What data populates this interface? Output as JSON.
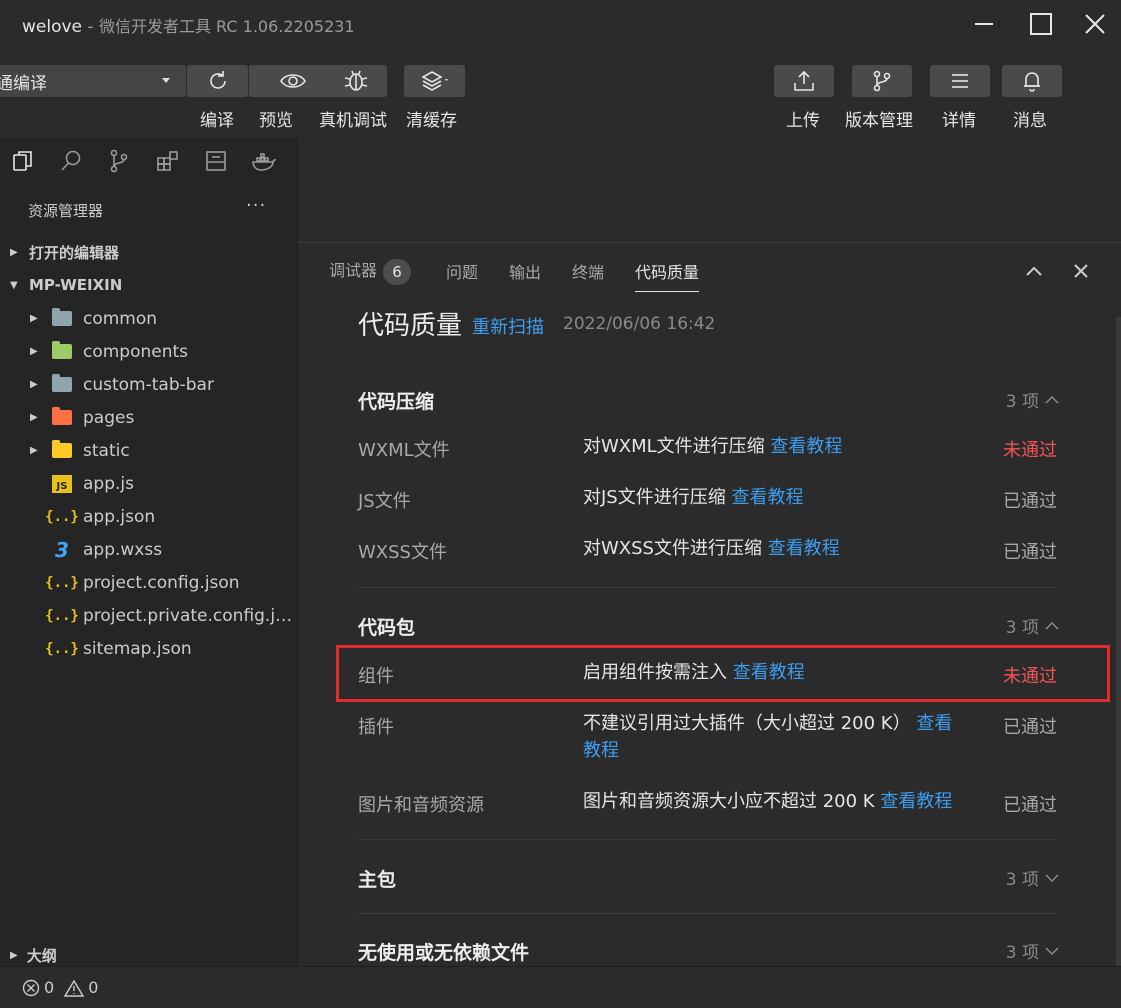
{
  "window": {
    "app_name": "welove",
    "separator": "-",
    "subtitle": "微信开发者工具 RC 1.06.2205231"
  },
  "toolbar": {
    "mode_value": "通编译",
    "compile_label": "编译",
    "preview_label": "预览",
    "debug_label": "真机调试",
    "clear_cache_label": "清缓存",
    "upload_label": "上传",
    "version_label": "版本管理",
    "details_label": "详情",
    "messages_label": "消息"
  },
  "sidebar": {
    "explorer_title": "资源管理器",
    "more": "···",
    "open_editors": "打开的编辑器",
    "project": "MP-WEIXIN",
    "outline": "大纲",
    "tree": [
      {
        "name": "common"
      },
      {
        "name": "components"
      },
      {
        "name": "custom-tab-bar"
      },
      {
        "name": "pages"
      },
      {
        "name": "static"
      },
      {
        "name": "app.js"
      },
      {
        "name": "app.json"
      },
      {
        "name": "app.wxss"
      },
      {
        "name": "project.config.json"
      },
      {
        "name": "project.private.config.js..."
      },
      {
        "name": "sitemap.json"
      }
    ]
  },
  "panel": {
    "tabs": [
      {
        "label": "调试器",
        "badge": "6"
      },
      {
        "label": "问题"
      },
      {
        "label": "输出"
      },
      {
        "label": "终端"
      },
      {
        "label": "代码质量"
      }
    ],
    "header": {
      "title": "代码质量",
      "rescan": "重新扫描",
      "timestamp": "2022/06/06 16:42"
    },
    "groups": [
      {
        "title": "代码压缩",
        "count": "3 项",
        "rows": [
          {
            "name": "WXML文件",
            "desc": "对WXML文件进行压缩",
            "link": "查看教程",
            "status": "未通过"
          },
          {
            "name": "JS文件",
            "desc": "对JS文件进行压缩",
            "link": "查看教程",
            "status": "已通过"
          },
          {
            "name": "WXSS文件",
            "desc": "对WXSS文件进行压缩",
            "link": "查看教程",
            "status": "已通过"
          }
        ]
      },
      {
        "title": "代码包",
        "count": "3 项",
        "rows": [
          {
            "name": "组件",
            "desc": "启用组件按需注入",
            "link": "查看教程",
            "status": "未通过"
          },
          {
            "name": "插件",
            "desc": "不建议引用过大插件（大小超过 200 K）",
            "link_a": "查看",
            "link_b": "教程",
            "status": "已通过"
          },
          {
            "name": "图片和音频资源",
            "desc": "图片和音频资源大小应不超过 200 K",
            "link": "查看教程",
            "status": "已通过"
          }
        ]
      },
      {
        "title": "主包",
        "count": "3 项"
      },
      {
        "title": "无使用或无依赖文件",
        "count": "3 项"
      }
    ]
  },
  "statusbar": {
    "errors": "0",
    "warnings": "0"
  },
  "colors": {
    "link": "#3c9df0",
    "fail": "#f05454",
    "highlight": "#e22b2b"
  }
}
